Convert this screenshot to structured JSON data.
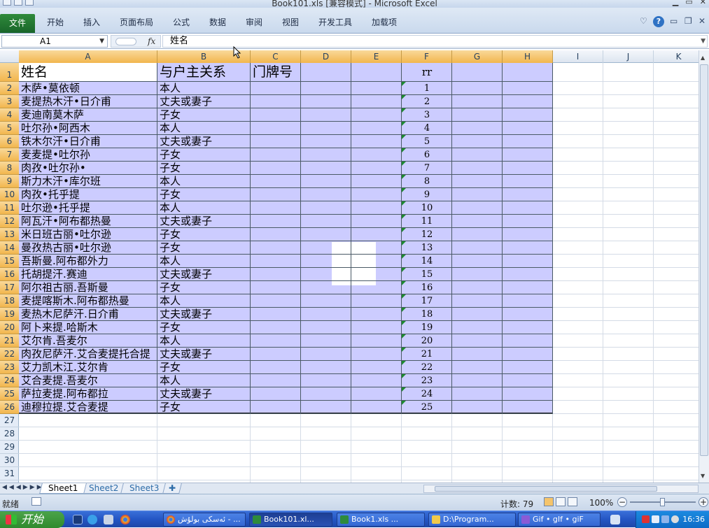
{
  "window": {
    "title": "Book101.xls  [兼容模式]  -  Microsoft Excel"
  },
  "ribbon": {
    "file_tab": "文件",
    "tabs": [
      "开始",
      "插入",
      "页面布局",
      "公式",
      "数据",
      "审阅",
      "视图",
      "开发工具",
      "加载项"
    ]
  },
  "formula_bar": {
    "name_box": "A1",
    "fx_label": "fx",
    "content": "姓名"
  },
  "columns": [
    "A",
    "B",
    "C",
    "D",
    "E",
    "F",
    "G",
    "H",
    "I",
    "J",
    "K"
  ],
  "rows": [
    "1",
    "2",
    "3",
    "4",
    "5",
    "6",
    "7",
    "8",
    "9",
    "10",
    "11",
    "12",
    "13",
    "14",
    "15",
    "16",
    "17",
    "18",
    "19",
    "20",
    "21",
    "22",
    "23",
    "24",
    "25",
    "26",
    "27",
    "28",
    "29",
    "30",
    "31"
  ],
  "sheet": {
    "headers": {
      "a": "姓名",
      "b": "与户主关系",
      "c": "门牌号",
      "f": "rr"
    },
    "records": [
      {
        "name": "木萨•莫依顿",
        "relation": "本人",
        "rr": "1"
      },
      {
        "name": "麦提热木汗•日介甫",
        "relation": "丈夫或妻子",
        "rr": "2"
      },
      {
        "name": "麦迪南莫木萨",
        "relation": "子女",
        "rr": "3"
      },
      {
        "name": "吐尔孙•阿西木",
        "relation": "本人",
        "rr": "4"
      },
      {
        "name": "铁木尔汗•日介甫",
        "relation": "丈夫或妻子",
        "rr": "5"
      },
      {
        "name": "麦麦提•吐尔孙",
        "relation": "子女",
        "rr": "6"
      },
      {
        "name": "肉孜•吐尔孙•",
        "relation": "子女",
        "rr": "7"
      },
      {
        "name": "斯力木汗•库尔班",
        "relation": "本人",
        "rr": "8"
      },
      {
        "name": "肉孜•托乎提",
        "relation": "子女",
        "rr": "9"
      },
      {
        "name": "吐尔逊•托乎提",
        "relation": "本人",
        "rr": "10"
      },
      {
        "name": "阿瓦汗•阿布都热曼",
        "relation": "丈夫或妻子",
        "rr": "11"
      },
      {
        "name": "米日班古丽•吐尔逊",
        "relation": "子女",
        "rr": "12"
      },
      {
        "name": "曼孜热古丽•吐尔逊",
        "relation": "子女",
        "rr": "13"
      },
      {
        "name": "吾斯曼.阿布都外力",
        "relation": "本人",
        "rr": "14"
      },
      {
        "name": "托胡提汗.赛迪",
        "relation": "丈夫或妻子",
        "rr": "15"
      },
      {
        "name": "阿尔祖古丽.吾斯曼",
        "relation": "子女",
        "rr": "16"
      },
      {
        "name": "麦提喀斯木.阿布都热曼",
        "relation": "本人",
        "rr": "17"
      },
      {
        "name": "麦热木尼萨汗.日介甫",
        "relation": "丈夫或妻子",
        "rr": "18"
      },
      {
        "name": "阿卜来提.哈斯木",
        "relation": "子女",
        "rr": "19"
      },
      {
        "name": "艾尔肯.吾麦尔",
        "relation": "本人",
        "rr": "20"
      },
      {
        "name": "肉孜尼萨汗.艾合麦提托合提",
        "relation": "丈夫或妻子",
        "rr": "21"
      },
      {
        "name": "艾力凯木江.艾尔肯",
        "relation": "子女",
        "rr": "22"
      },
      {
        "name": "艾合麦提.吾麦尔",
        "relation": "本人",
        "rr": "23"
      },
      {
        "name": "萨拉麦提.阿布都拉",
        "relation": "丈夫或妻子",
        "rr": "24"
      },
      {
        "name": "迪穆拉提.艾合麦提",
        "relation": "子女",
        "rr": "25"
      }
    ]
  },
  "sheet_tabs": [
    "Sheet1",
    "Sheet2",
    "Sheet3"
  ],
  "status": {
    "ready": "就绪",
    "count": "计数: 79",
    "zoom": "100%"
  },
  "taskbar": {
    "start": "开始",
    "items": [
      "ئەسكى بولۇش - ...",
      "Book101.xl...",
      "Book1.xls ...",
      "D:\\Program...",
      "Gif • gIf • giF"
    ],
    "clock": "16:36"
  },
  "colors": {
    "selection": "#ccccff",
    "file_tab": "#2a7a35",
    "green_indicator": "#1c8a2f"
  }
}
